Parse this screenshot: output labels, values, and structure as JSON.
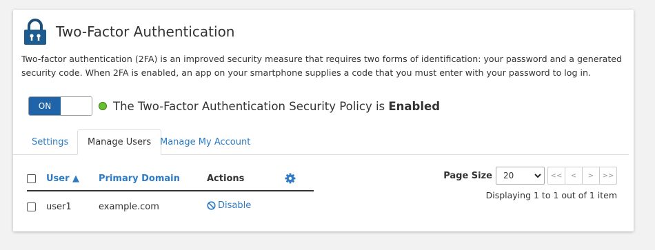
{
  "header": {
    "title": "Two-Factor Authentication",
    "description": "Two-factor authentication (2FA) is an improved security measure that requires two forms of identification: your password and a generated security code. When 2FA is enabled, an app on your smartphone supplies a code that you must enter with your password to log in."
  },
  "policy": {
    "toggle_label": "ON",
    "status_prefix": "The Two-Factor Authentication Security Policy is ",
    "status_value": "Enabled",
    "status_color": "#6abf30"
  },
  "tabs": [
    {
      "label": "Settings"
    },
    {
      "label": "Manage Users"
    },
    {
      "label": "Manage My Account"
    }
  ],
  "table": {
    "columns": {
      "user": "User ▲",
      "domain": "Primary Domain",
      "actions": "Actions"
    },
    "rows": [
      {
        "user": "user1",
        "domain": "example.com",
        "action": "Disable"
      }
    ]
  },
  "pager": {
    "page_size_label": "Page Size",
    "page_size_value": "20",
    "first": "<<",
    "prev": "<",
    "next": ">",
    "last": ">>",
    "displaying": "Displaying 1 to 1 out of 1 item"
  },
  "colors": {
    "accent": "#2c7bc4",
    "toggle_on": "#1f63a8"
  }
}
